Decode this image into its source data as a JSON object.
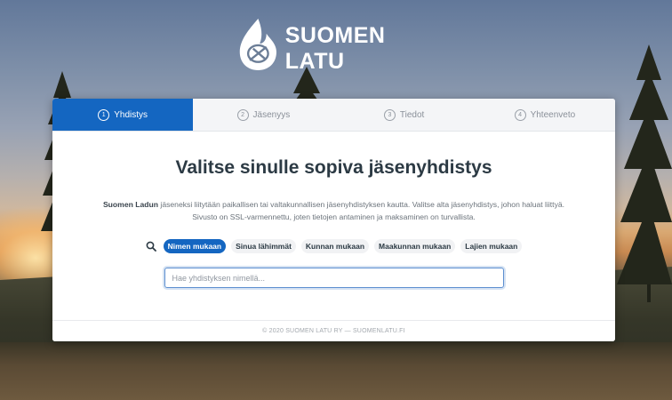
{
  "brand": {
    "name": "SUOMEN LATU"
  },
  "steps": [
    {
      "num": "1",
      "label": "Yhdistys",
      "active": true
    },
    {
      "num": "2",
      "label": "Jäsenyys",
      "active": false
    },
    {
      "num": "3",
      "label": "Tiedot",
      "active": false
    },
    {
      "num": "4",
      "label": "Yhteenveto",
      "active": false
    }
  ],
  "main": {
    "title": "Valitse sinulle sopiva jäsenyhdistys",
    "desc_bold": "Suomen Ladun",
    "desc_line1": " jäseneksi liitytään paikallisen tai valtakunnallisen jäsenyhdistyksen kautta. Valitse alta jäsenyhdistys, johon haluat liittyä.",
    "desc_line2": "Sivusto on SSL-varmennettu, joten tietojen antaminen ja maksaminen on turvallista."
  },
  "filters": [
    {
      "label": "Nimen mukaan",
      "active": true
    },
    {
      "label": "Sinua lähimmät",
      "active": false
    },
    {
      "label": "Kunnan mukaan",
      "active": false
    },
    {
      "label": "Maakunnan mukaan",
      "active": false
    },
    {
      "label": "Lajien mukaan",
      "active": false
    }
  ],
  "search": {
    "placeholder": "Hae yhdistyksen nimellä...",
    "value": ""
  },
  "footer": {
    "text": "© 2020 SUOMEN LATU RY — SUOMENLATU.FI"
  },
  "colors": {
    "accent": "#1466c1",
    "title": "#2c3a44",
    "muted": "#8a9099"
  }
}
